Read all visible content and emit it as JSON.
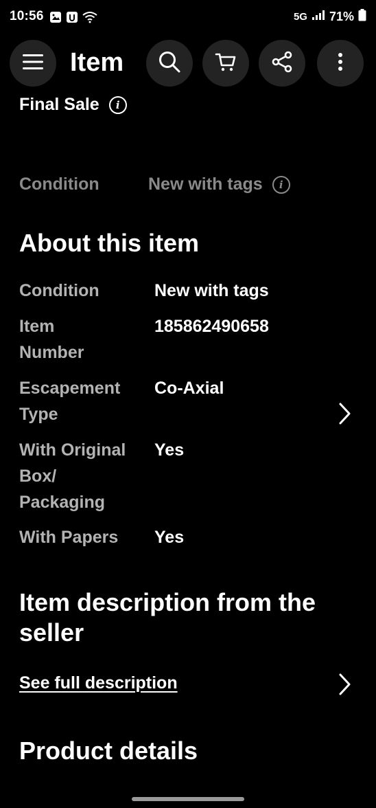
{
  "status_bar": {
    "time": "10:56",
    "network": "5G",
    "battery": "71%"
  },
  "header": {
    "title": "Item",
    "menu_icon": "hamburger-menu-icon",
    "search_icon": "search-icon",
    "cart_icon": "cart-icon",
    "share_icon": "share-icon",
    "more_icon": "more-vertical-icon"
  },
  "final_sale": {
    "label": "Final Sale"
  },
  "condition_top": {
    "label": "Condition",
    "value": "New with tags"
  },
  "about": {
    "title": "About this item",
    "specs": [
      {
        "key": "Condition",
        "value": "New with tags"
      },
      {
        "key": "Item Number",
        "value": "185862490658"
      },
      {
        "key": "Escapement Type",
        "value": "Co-Axial"
      },
      {
        "key": "With Original Box/ Packaging",
        "value": "Yes"
      },
      {
        "key": "With Papers",
        "value": "Yes"
      }
    ]
  },
  "description": {
    "title": "Item description from the seller",
    "link": "See full description"
  },
  "product_details": {
    "title": "Product details"
  }
}
